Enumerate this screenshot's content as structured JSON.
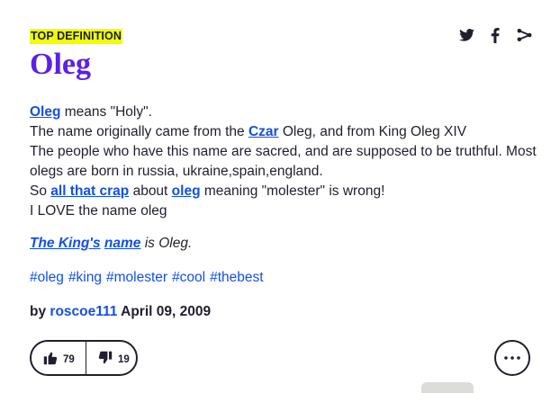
{
  "badge": "TOP DEFINITION",
  "share_icons": [
    "twitter-icon",
    "facebook-icon",
    "share-icon"
  ],
  "word": "Oleg",
  "meaning": {
    "line1": {
      "link": "Oleg",
      "text": " means \"Holy\"."
    },
    "line2": {
      "pre": "The name originally came from the ",
      "link": "Czar",
      "post": " Oleg, and from King Oleg XIV"
    },
    "line3": "The people who have this name are sacred, and are supposed to be truthful. Most",
    "line4": "olegs are born in russia, ukraine,spain,england.",
    "line5": {
      "pre": "So ",
      "link1": "all that crap",
      "mid": " about ",
      "link2": "oleg",
      "post": " meaning \"molester\" is wrong!"
    },
    "line6": "I LOVE the name oleg"
  },
  "example": {
    "link1": "The King's",
    "space": " ",
    "link2": "name",
    "post": " is Oleg."
  },
  "tags": [
    "#oleg",
    "#king",
    "#molester",
    "#cool",
    "#thebest"
  ],
  "byline": {
    "by": "by ",
    "author": "roscoe111",
    "date": " April 09, 2009"
  },
  "votes": {
    "up": "79",
    "down": "19"
  },
  "colors": {
    "accent": "#134fe6",
    "badge_bg": "#efff00",
    "title": "#5b21e6"
  }
}
